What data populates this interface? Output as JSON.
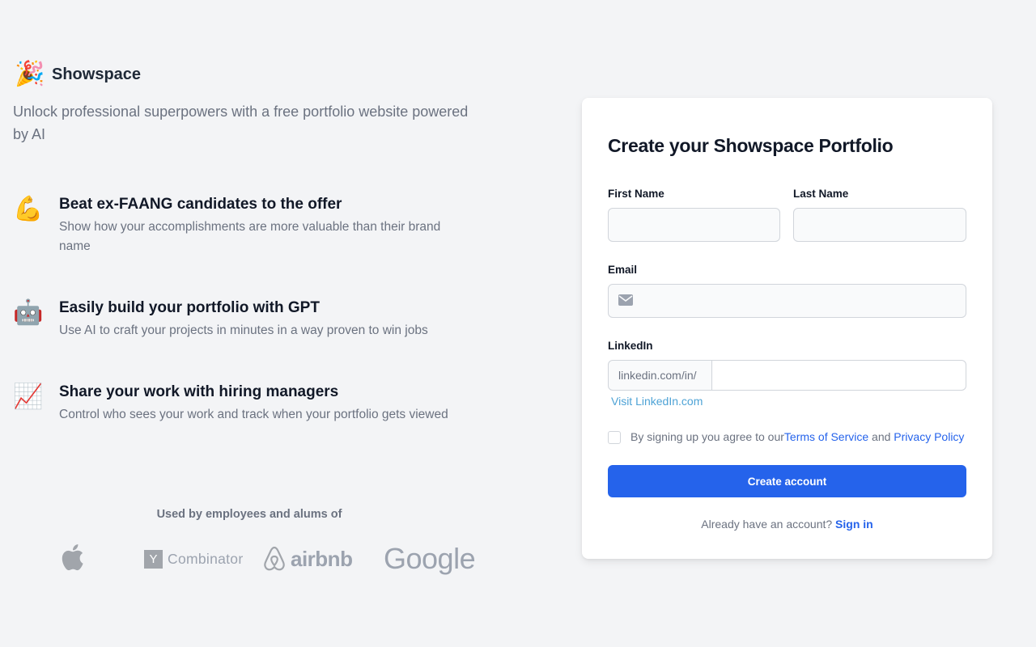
{
  "brand": {
    "icon": "🎉",
    "name": "Showspace"
  },
  "tagline": "Unlock professional superpowers with a free portfolio website powered by AI",
  "features": [
    {
      "icon": "💪",
      "title": "Beat ex-FAANG candidates to the offer",
      "desc": "Show how your accomplishments are more valuable than their brand name"
    },
    {
      "icon": "🤖",
      "title": "Easily build your portfolio with GPT",
      "desc": "Use AI to craft your projects in minutes in a way proven to win jobs"
    },
    {
      "icon": "📈",
      "title": "Share your work with hiring managers",
      "desc": "Control who sees your work and track when your portfolio gets viewed"
    }
  ],
  "used_by": {
    "label": "Used by employees and alums of",
    "logos": {
      "yc_letter": "Y",
      "yc_name": "Combinator",
      "airbnb": "airbnb",
      "google": "Google"
    }
  },
  "form": {
    "title": "Create your Showspace Portfolio",
    "first_name_label": "First Name",
    "last_name_label": "Last Name",
    "email_label": "Email",
    "linkedin_label": "LinkedIn",
    "linkedin_prefix": "linkedin.com/in/",
    "visit_linkedin": "Visit LinkedIn.com",
    "terms_prefix": "By signing up you agree to our",
    "terms_link": "Terms of Service",
    "terms_and": "and",
    "privacy_link": "Privacy Policy",
    "submit": "Create account",
    "signin_prompt": "Already have an account?",
    "signin_link": "Sign in"
  },
  "colors": {
    "accent": "#2563eb",
    "link_light": "#4ea3d6",
    "muted": "#6b7280",
    "logo_gray": "#9ca3af"
  }
}
